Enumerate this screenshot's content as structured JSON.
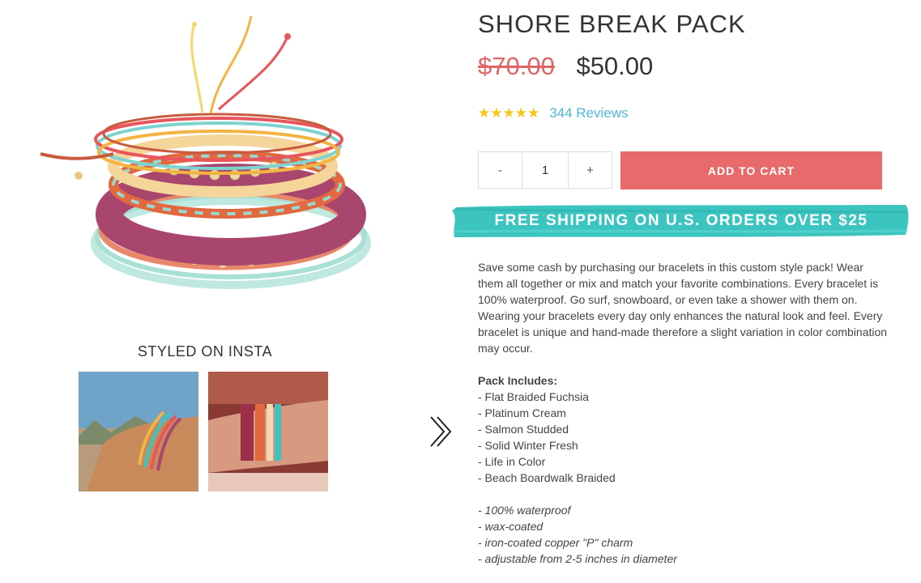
{
  "product": {
    "title": "SHORE BREAK PACK",
    "old_price": "$70.00",
    "price": "$50.00",
    "rating_stars": "★★★★★",
    "reviews_label": "344 Reviews"
  },
  "cart": {
    "minus_label": "-",
    "quantity": "1",
    "plus_label": "+",
    "add_to_cart_label": "ADD TO CART"
  },
  "banner": {
    "text": "FREE SHIPPING ON U.S. ORDERS OVER $25",
    "color": "#3cc5c0"
  },
  "insta": {
    "heading": "STYLED ON INSTA"
  },
  "description": {
    "intro": "Save some cash by purchasing our bracelets in this custom style pack! Wear them all together or mix and match your favorite combinations. Every bracelet is 100% waterproof. Go surf, snowboard, or even take a shower with them on. Wearing your bracelets every day only enhances the natural look and feel. Every bracelet is unique and hand-made therefore a slight variation in color combination may occur.",
    "pack_title": "Pack Includes:",
    "pack_items": [
      "- Flat Braided Fuchsia",
      "- Platinum Cream",
      "- Salmon Studded",
      "- Solid Winter Fresh",
      "- Life in Color",
      "- Beach Boardwalk Braided"
    ],
    "features": [
      "- 100% waterproof",
      "- wax-coated",
      "- iron-coated copper \"P\" charm",
      "- adjustable from 2-5 inches in diameter"
    ]
  },
  "colors": {
    "accent_red": "#e86a6a",
    "old_price": "#e06666",
    "link_blue": "#4cb8d6",
    "star_yellow": "#f5c518"
  }
}
